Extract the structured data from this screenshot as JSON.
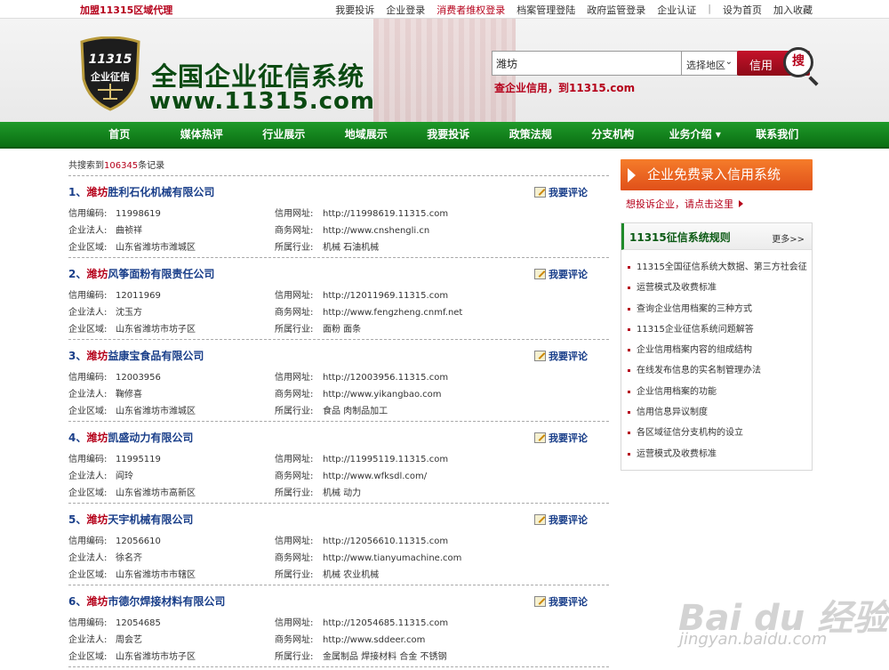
{
  "topbar": {
    "agent": "加盟11315区域代理",
    "links": [
      "我要投诉",
      "企业登录",
      "消费者维权登录",
      "档案管理登陆",
      "政府监管登录",
      "企业认证",
      "|",
      "设为首页",
      "加入收藏"
    ]
  },
  "header": {
    "shield_number": "11315",
    "shield_text": "企业征信",
    "title": "全国企业征信系统",
    "url": "www.11315.com",
    "search_value": "潍坊",
    "region": "选择地区",
    "search_button": "信用",
    "search_icon_text": "搜",
    "slogan": "查企业信用，到11315.com"
  },
  "nav": [
    "首页",
    "媒体热评",
    "行业展示",
    "地域展示",
    "我要投诉",
    "政策法规",
    "分支机构",
    "业务介绍 ▾",
    "联系我们"
  ],
  "results": {
    "count_prefix": "共搜索到",
    "count": "106345",
    "count_suffix": "条记录",
    "comment_label": "我要评论",
    "labels": {
      "code": "信用编码:",
      "legal": "企业法人:",
      "area": "企业区域:",
      "site": "信用网址:",
      "biz": "商务网址:",
      "industry": "所属行业:"
    },
    "items": [
      {
        "index": "1、",
        "city": "潍坊",
        "name": "胜利石化机械有限公司",
        "code": "11998619",
        "legal": "曲祯祥",
        "area": "山东省潍坊市潍城区",
        "site": "http://11998619.11315.com",
        "biz": "http://www.cnshengli.cn",
        "industry": "机械 石油机械"
      },
      {
        "index": "2、",
        "city": "潍坊",
        "name": "风筝面粉有限责任公司",
        "code": "12011969",
        "legal": "沈玉方",
        "area": "山东省潍坊市坊子区",
        "site": "http://12011969.11315.com",
        "biz": "http://www.fengzheng.cnmf.net",
        "industry": "面粉 面条"
      },
      {
        "index": "3、",
        "city": "潍坊",
        "name": "益康宝食品有限公司",
        "code": "12003956",
        "legal": "鞠修喜",
        "area": "山东省潍坊市潍城区",
        "site": "http://12003956.11315.com",
        "biz": "http://www.yikangbao.com",
        "industry": "食品 肉制品加工"
      },
      {
        "index": "4、",
        "city": "潍坊",
        "name": "凯盛动力有限公司",
        "code": "11995119",
        "legal": "阎玲",
        "area": "山东省潍坊市高新区",
        "site": "http://11995119.11315.com",
        "biz": "http://www.wfksdl.com/",
        "industry": "机械 动力"
      },
      {
        "index": "5、",
        "city": "潍坊",
        "name": "天宇机械有限公司",
        "code": "12056610",
        "legal": "徐名齐",
        "area": "山东省潍坊市市辖区",
        "site": "http://12056610.11315.com",
        "biz": "http://www.tianyumachine.com",
        "industry": "机械 农业机械"
      },
      {
        "index": "6、",
        "city": "潍坊",
        "name": "市德尔焊接材料有限公司",
        "code": "12054685",
        "legal": "周会艺",
        "area": "山东省潍坊市坊子区",
        "site": "http://12054685.11315.com",
        "biz": "http://www.sddeer.com",
        "industry": "金属制品 焊接材料 合金 不锈钢"
      }
    ]
  },
  "sidebar": {
    "promo": "企业免费录入信用系统",
    "complain": "想投诉企业，请点击这里",
    "rules_title": "11315征信系统规则",
    "more": "更多>>",
    "rules": [
      "11315全国征信系统大数据、第三方社会征",
      "运营模式及收费标准",
      "查询企业信用档案的三种方式",
      "11315企业征信系统问题解答",
      "企业信用档案内容的组成结构",
      "在线发布信息的实名制管理办法",
      "企业信用档案的功能",
      "信用信息异议制度",
      "各区域征信分支机构的设立",
      "运营模式及收费标准"
    ]
  },
  "watermark": {
    "text": "Bai du 经验",
    "sub": "jingyan.baidu.com"
  },
  "colors": {
    "brand_red": "#b5001a",
    "nav_green": "#0a6e12",
    "title_green": "#0b4a12",
    "promo_orange": "#f57c2a"
  }
}
